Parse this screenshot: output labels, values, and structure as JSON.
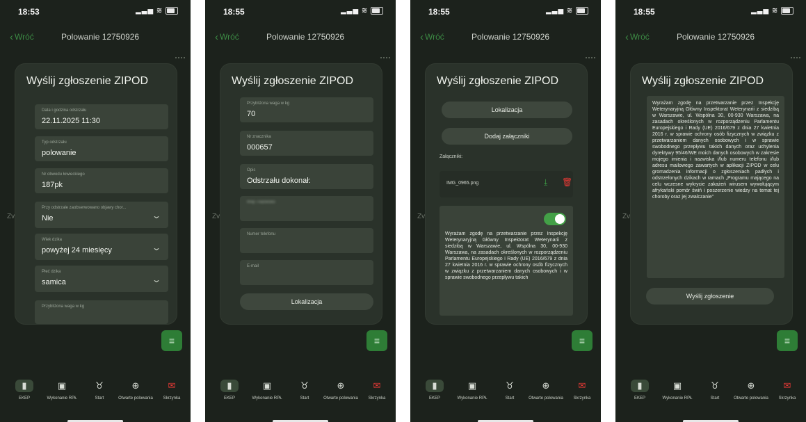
{
  "common": {
    "back_label": "Wróć",
    "nav_title": "Polowanie 12750926",
    "modal_title": "Wyślij zgłoszenie ZIPOD",
    "menu_icon": "menu-icon",
    "underlay_letters": "Zv",
    "tabs": [
      {
        "label": "EKEP",
        "icon": "ekep-icon"
      },
      {
        "label": "Wykonanie RPŁ",
        "icon": "calendar-icon"
      },
      {
        "label": "Start",
        "icon": "boar-icon"
      },
      {
        "label": "Otwarte polowania",
        "icon": "crosshair-icon"
      },
      {
        "label": "Skrzynka",
        "icon": "inbox-icon"
      }
    ]
  },
  "screens": [
    {
      "time": "18:53",
      "fields": [
        {
          "label": "Data i godzina odstrzału",
          "value": "22.11.2025 11:30"
        },
        {
          "label": "Typ odstrzału",
          "value": "polowanie"
        },
        {
          "label": "Nr obwodu łowieckiego",
          "value": "187pk"
        },
        {
          "label": "Przy odstrzale zaobserwowano objawy chor...",
          "value": "Nie"
        },
        {
          "label": "Wiek dzika",
          "value": "powyżej 24 miesięcy"
        },
        {
          "label": "Płeć dzika",
          "value": "samica"
        },
        {
          "label": "Przybliżona waga w kg",
          "value": ""
        }
      ]
    },
    {
      "time": "18:55",
      "fields": [
        {
          "label": "Przybliżona waga w kg",
          "value": "70"
        },
        {
          "label": "Nr znacznika",
          "value": "000657"
        },
        {
          "label": "Opis",
          "value": "Odstrzału dokonał:"
        },
        {
          "label": "Imię i nazwisko",
          "value": ""
        },
        {
          "label": "Numer telefonu",
          "value": ""
        },
        {
          "label": "E-mail",
          "value": ""
        }
      ],
      "button": "Lokalizacja"
    },
    {
      "time": "18:55",
      "buttons": [
        "Lokalizacja",
        "Dodaj załączniki"
      ],
      "attachments_label": "Załączniki:",
      "attachment_file": "IMG_0965.png",
      "consent_text": "Wyrażam zgodę na przetwarzanie przez Inspekcję Weterynaryjną Główny Inspektorat Weterynarii z siedzibą w Warszawie, ul. Wspólna 30, 00-930 Warszawa, na zasadach określonych w rozporządzeniu Parlamentu Europejskiego i Rady (UE) 2016/679 z dnia 27 kwietnia 2016 r. w sprawie ochrony osób fizycznych w związku z przetwarzaniem danych osobowych i w sprawie swobodnego przepływu takich"
    },
    {
      "time": "18:55",
      "consent_text": "Wyrażam zgodę na przetwarzanie przez Inspekcję Weterynaryjną Główny Inspektorat Weterynarii z siedzibą w Warszawie, ul. Wspólna 30, 00-930 Warszawa, na zasadach określonych w rozporządzeniu Parlamentu Europejskiego i Rady (UE) 2016/679 z dnia 27 kwietnia 2016 r. w sprawie ochrony osób fizycznych w związku z przetwarzaniem danych osobowych i w sprawie swobodnego przepływu takich danych oraz uchylenia dyrektywy 95/46/WE moich danych osobowych w zakresie mojego imienia i nazwiska i/lub numeru telefonu i/lub adresu mailowego zawartych w aplikacji ZIPOD w celu gromadzenia informacji o zgłoszeniach padłych i odstrzelonych dzikach w ramach „Programu mającego na celu wczesne wykrycie zakażeń wirusem wywołującym afrykański pomór świń i poszerzenie wiedzy na temat tej choroby oraz jej zwalczanie\"",
      "button": "Wyślij zgłoszenie"
    }
  ]
}
